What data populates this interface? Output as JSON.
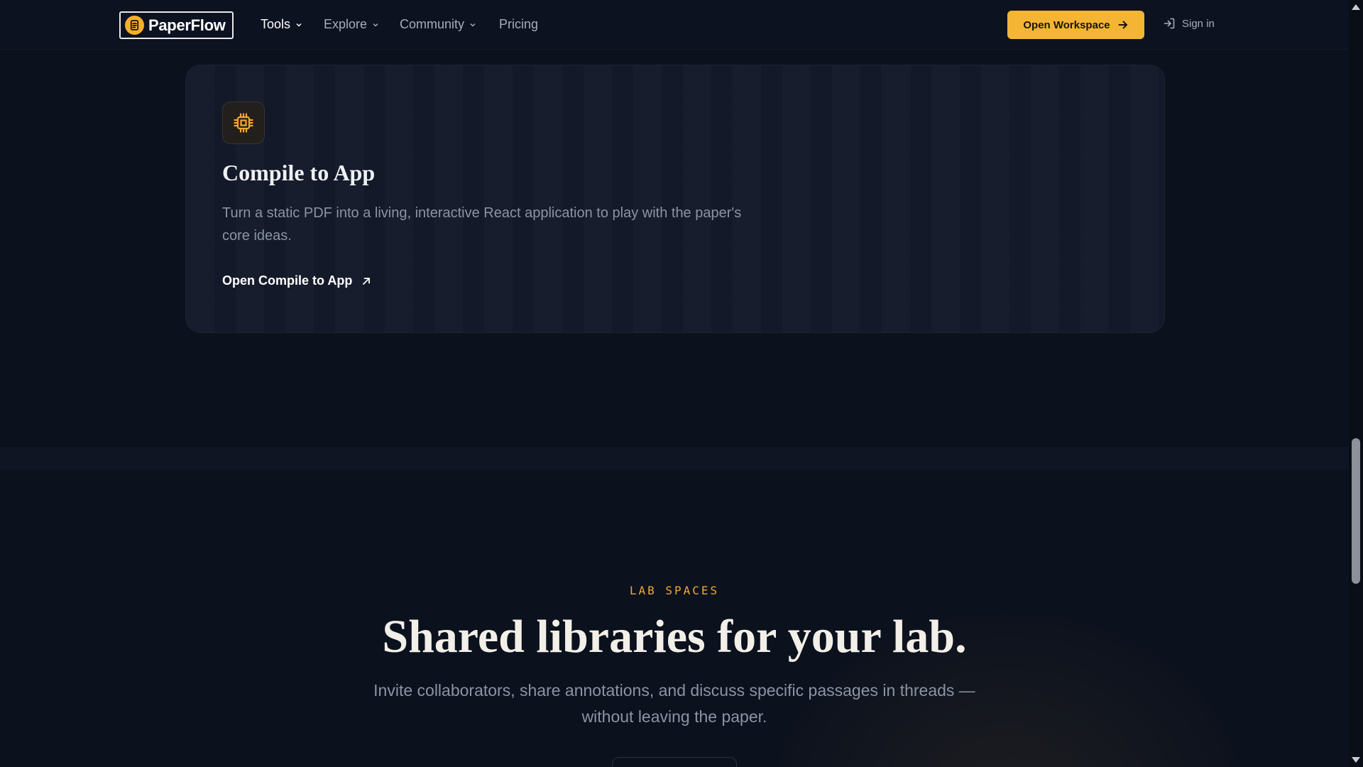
{
  "header": {
    "brand": "PaperFlow",
    "nav": [
      {
        "label": "Tools",
        "has_dropdown": true,
        "active": true
      },
      {
        "label": "Explore",
        "has_dropdown": true,
        "active": false
      },
      {
        "label": "Community",
        "has_dropdown": true,
        "active": false
      },
      {
        "label": "Pricing",
        "has_dropdown": false,
        "active": false
      }
    ],
    "open_workspace_label": "Open Workspace",
    "sign_in_label": "Sign in"
  },
  "feature_card": {
    "icon": "cpu-chip-icon",
    "title": "Compile to App",
    "description": "Turn a static PDF into a living, interactive React application to play with the paper's core ideas.",
    "link_label": "Open Compile to App"
  },
  "lab_section": {
    "eyebrow": "LAB SPACES",
    "headline": "Shared libraries for your lab.",
    "subtext": "Invite collaborators, share annotations, and discuss specific passages in threads — without leaving the paper."
  },
  "colors": {
    "background": "#0b111d",
    "accent": "#f4b535",
    "card": "#141a2a",
    "eyebrow": "#f0a93a"
  }
}
